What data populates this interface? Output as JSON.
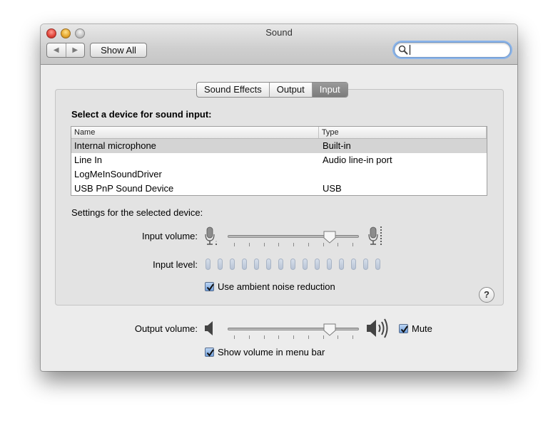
{
  "window": {
    "title": "Sound"
  },
  "toolbar": {
    "back_glyph": "◀",
    "forward_glyph": "▶",
    "show_all_label": "Show All"
  },
  "search": {
    "value": "",
    "placeholder": ""
  },
  "tabs": [
    {
      "label": "Sound Effects",
      "selected": false
    },
    {
      "label": "Output",
      "selected": false
    },
    {
      "label": "Input",
      "selected": true
    }
  ],
  "input": {
    "section_label": "Select a device for sound input:",
    "columns": {
      "name": "Name",
      "type": "Type"
    },
    "devices": [
      {
        "name": "Internal microphone",
        "type": "Built-in",
        "selected": true
      },
      {
        "name": "Line In",
        "type": "Audio line-in port",
        "selected": false
      },
      {
        "name": "LogMeInSoundDriver",
        "type": "",
        "selected": false
      },
      {
        "name": "USB PnP Sound Device",
        "type": "USB",
        "selected": false
      }
    ],
    "settings_label": "Settings for the selected device:",
    "volume_label": "Input volume:",
    "volume_level": 0.81,
    "level_label": "Input level:",
    "level_segments": 15,
    "level_active": 0,
    "ambient_noise_label": "Use ambient noise reduction",
    "ambient_noise_checked": true,
    "help_glyph": "?"
  },
  "output": {
    "volume_label": "Output volume:",
    "volume_level": 0.81,
    "mute_label": "Mute",
    "mute_checked": true,
    "menu_bar_label": "Show volume in menu bar",
    "menu_bar_checked": true
  },
  "colors": {
    "search_focus": "#8ab4ea",
    "checkbox_blue": "#6f9fdc",
    "selected_tab": "#8a8a8a",
    "selected_row": "#d4d4d4"
  }
}
